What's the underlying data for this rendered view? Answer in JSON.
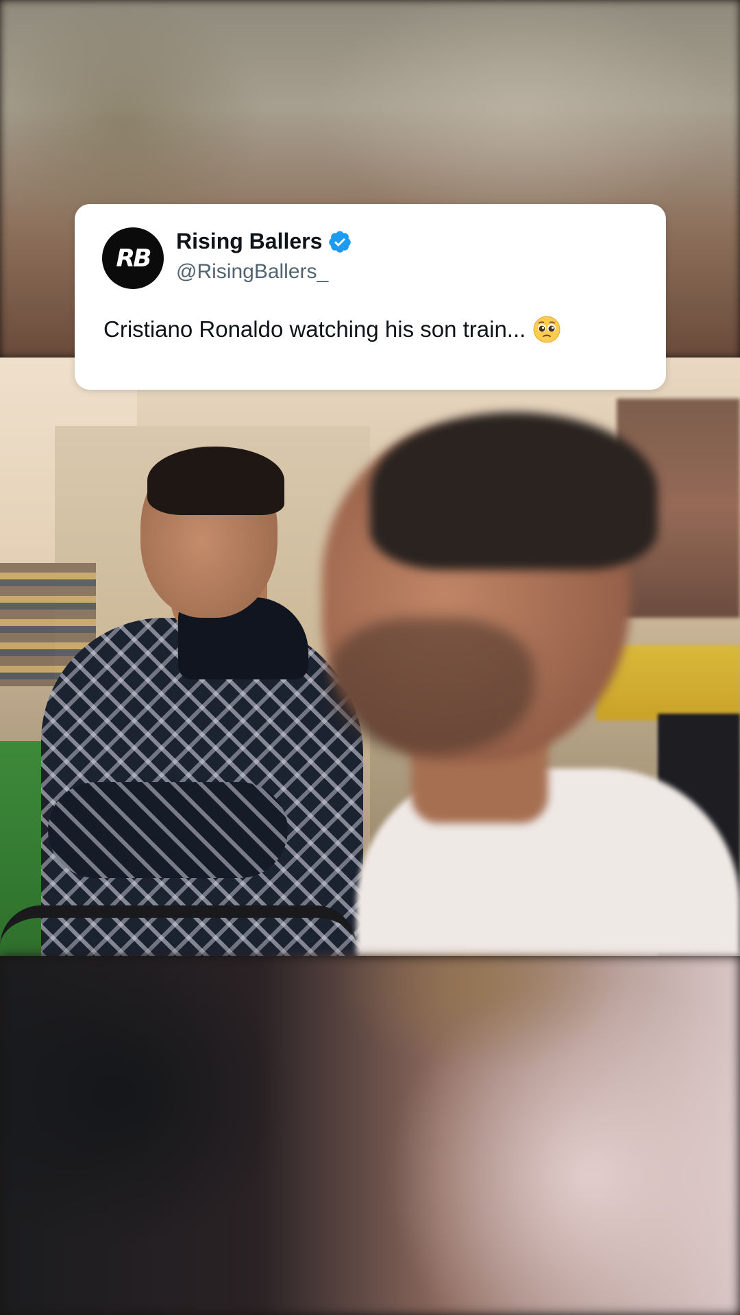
{
  "tweet": {
    "avatar_initials": "RB",
    "display_name": "Rising Ballers",
    "handle": "@RisingBallers_",
    "text": "Cristiano Ronaldo watching his son train...",
    "verified": true,
    "verified_icon": "verified-badge-icon",
    "emoji_icon": "pleading-face-emoji-icon"
  },
  "colors": {
    "card_bg": "#ffffff",
    "name_color": "#0f1419",
    "handle_color": "#536471",
    "verified_color": "#1d9bf0"
  }
}
